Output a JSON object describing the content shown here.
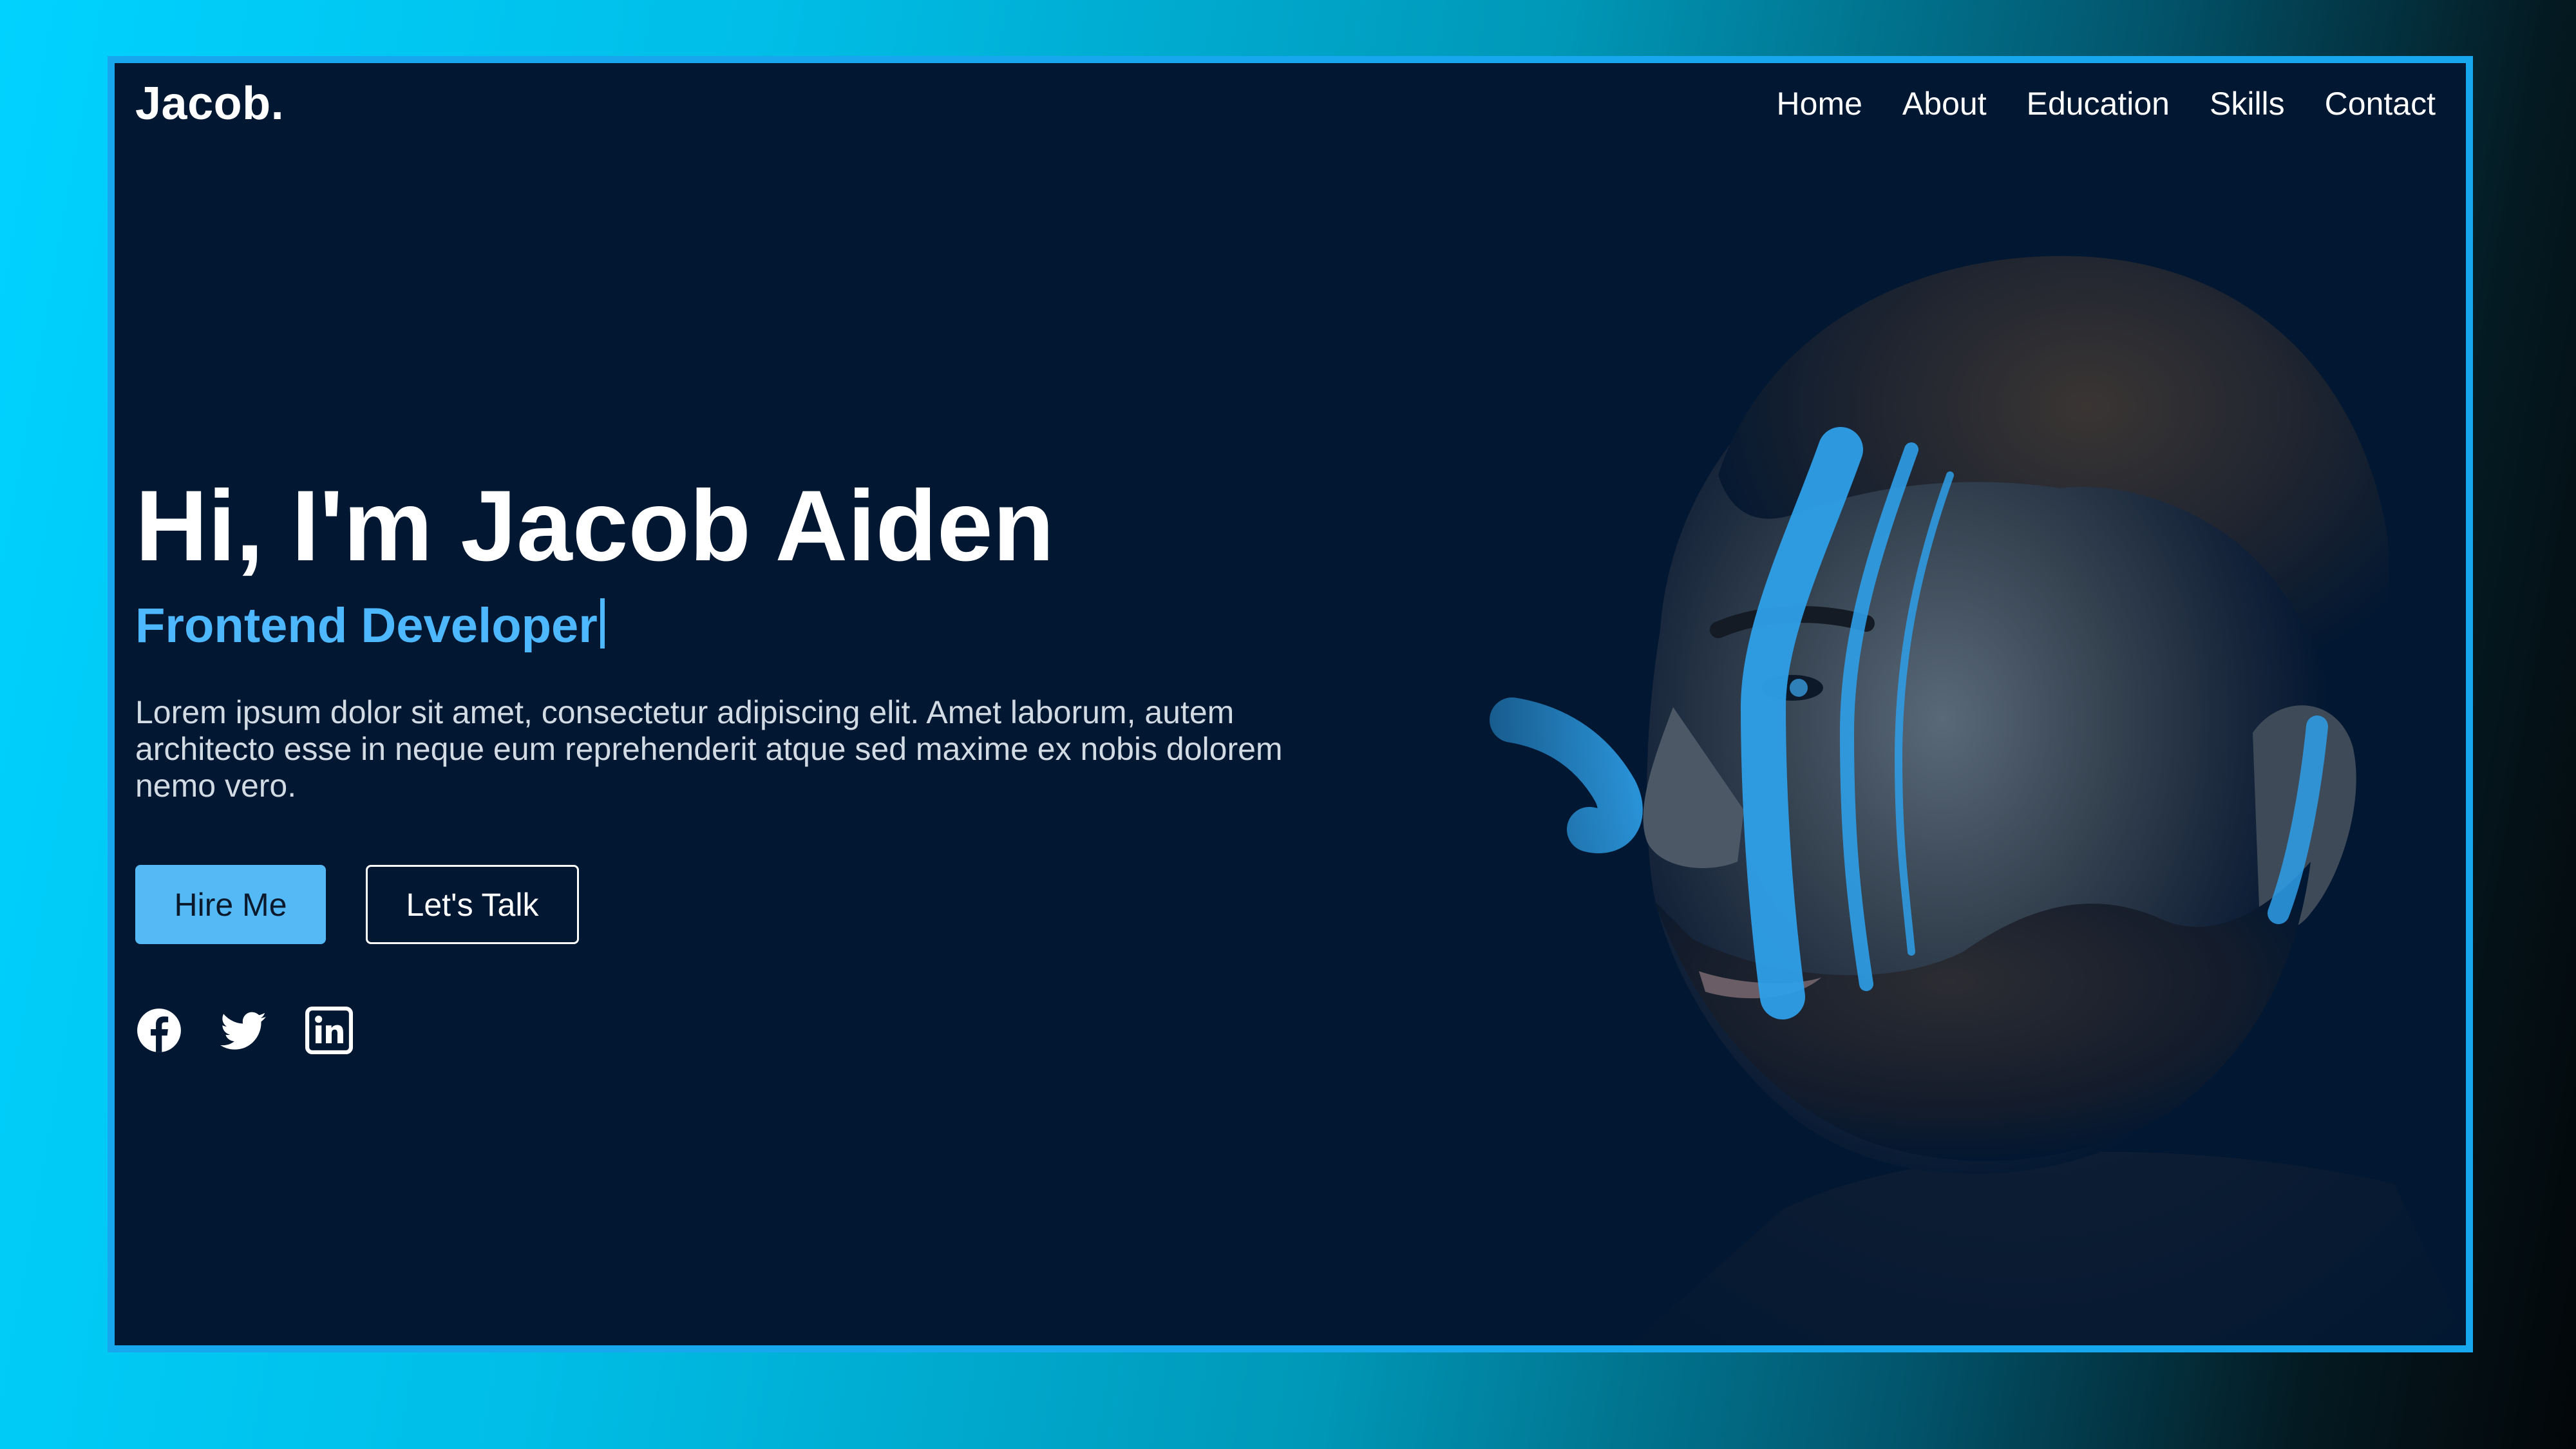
{
  "brand": {
    "logo": "Jacob."
  },
  "nav": {
    "items": [
      {
        "label": "Home"
      },
      {
        "label": "About"
      },
      {
        "label": "Education"
      },
      {
        "label": "Skills"
      },
      {
        "label": "Contact"
      }
    ]
  },
  "hero": {
    "title": "Hi, I'm Jacob Aiden",
    "role": "Frontend Developer",
    "description": "Lorem ipsum dolor sit amet, consectetur adipiscing elit. Amet laborum, autem architecto esse in neque eum reprehenderit atque sed maxime ex nobis dolorem nemo vero.",
    "primary_button": "Hire Me",
    "secondary_button": "Let's Talk"
  },
  "socials": [
    {
      "icon": "facebook-icon"
    },
    {
      "icon": "twitter-icon"
    },
    {
      "icon": "linkedin-icon"
    }
  ],
  "colors": {
    "accent": "#4db8ff",
    "frame_border": "#16a7ef",
    "background": "#021731",
    "button_primary": "#54b9f4"
  }
}
